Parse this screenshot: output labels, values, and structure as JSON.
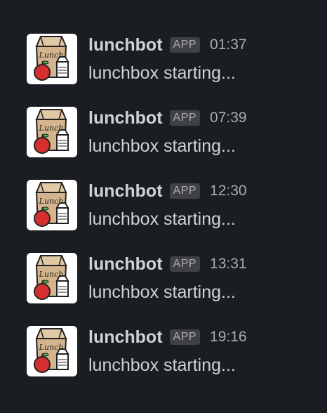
{
  "messages": [
    {
      "avatar_icon": "lunch-bag-apple-milk-icon",
      "avatar_text": "Lunch",
      "sender": "lunchbot",
      "badge": "APP",
      "timestamp": "01:37",
      "text": "lunchbox starting..."
    },
    {
      "avatar_icon": "lunch-bag-apple-milk-icon",
      "avatar_text": "Lunch",
      "sender": "lunchbot",
      "badge": "APP",
      "timestamp": "07:39",
      "text": "lunchbox starting..."
    },
    {
      "avatar_icon": "lunch-bag-apple-milk-icon",
      "avatar_text": "Lunch",
      "sender": "lunchbot",
      "badge": "APP",
      "timestamp": "12:30",
      "text": "lunchbox starting..."
    },
    {
      "avatar_icon": "lunch-bag-apple-milk-icon",
      "avatar_text": "Lunch",
      "sender": "lunchbot",
      "badge": "APP",
      "timestamp": "13:31",
      "text": "lunchbox starting..."
    },
    {
      "avatar_icon": "lunch-bag-apple-milk-icon",
      "avatar_text": "Lunch",
      "sender": "lunchbot",
      "badge": "APP",
      "timestamp": "19:16",
      "text": "lunchbox starting..."
    }
  ],
  "colors": {
    "background": "#1a1d21",
    "text": "#d1d2d3",
    "muted": "#ababad",
    "badge_bg": "#3f4145",
    "bag": "#d4b48c",
    "apple": "#d62f2f"
  }
}
